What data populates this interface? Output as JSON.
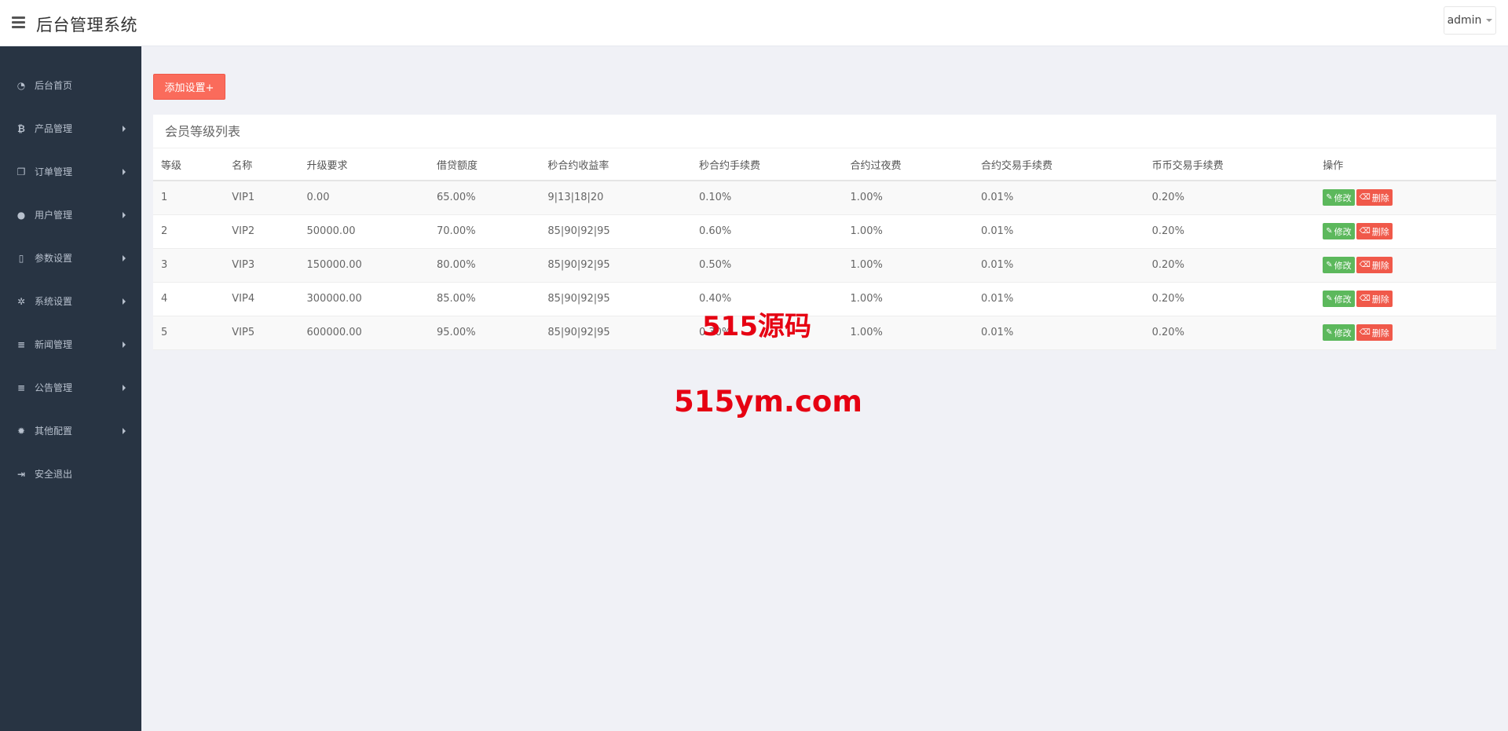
{
  "header": {
    "title": "后台管理系统",
    "user": "admin"
  },
  "sidebar": {
    "items": [
      {
        "label": "后台首页",
        "icon": "dashboard-icon",
        "has_arrow": false
      },
      {
        "label": "产品管理",
        "icon": "bitcoin-icon",
        "has_arrow": true
      },
      {
        "label": "订单管理",
        "icon": "copy-icon",
        "has_arrow": true
      },
      {
        "label": "用户管理",
        "icon": "user-icon",
        "has_arrow": true
      },
      {
        "label": "参数设置",
        "icon": "file-icon",
        "has_arrow": true
      },
      {
        "label": "系统设置",
        "icon": "gears-icon",
        "has_arrow": true
      },
      {
        "label": "新闻管理",
        "icon": "list-icon",
        "has_arrow": true
      },
      {
        "label": "公告管理",
        "icon": "list-icon",
        "has_arrow": true
      },
      {
        "label": "其他配置",
        "icon": "gear-icon",
        "has_arrow": true
      },
      {
        "label": "安全退出",
        "icon": "sign-out-icon",
        "has_arrow": false
      }
    ]
  },
  "main": {
    "add_button": "添加设置+",
    "panel_title": "会员等级列表",
    "table": {
      "headers": [
        "等级",
        "名称",
        "升级要求",
        "借贷额度",
        "秒合约收益率",
        "秒合约手续费",
        "合约过夜费",
        "合约交易手续费",
        "币币交易手续费",
        "操作"
      ],
      "rows": [
        [
          "1",
          "VIP1",
          "0.00",
          "65.00%",
          "9|13|18|20",
          "0.10%",
          "1.00%",
          "0.01%",
          "0.20%"
        ],
        [
          "2",
          "VIP2",
          "50000.00",
          "70.00%",
          "85|90|92|95",
          "0.60%",
          "1.00%",
          "0.01%",
          "0.20%"
        ],
        [
          "3",
          "VIP3",
          "150000.00",
          "80.00%",
          "85|90|92|95",
          "0.50%",
          "1.00%",
          "0.01%",
          "0.20%"
        ],
        [
          "4",
          "VIP4",
          "300000.00",
          "85.00%",
          "85|90|92|95",
          "0.40%",
          "1.00%",
          "0.01%",
          "0.20%"
        ],
        [
          "5",
          "VIP5",
          "600000.00",
          "95.00%",
          "85|90|92|95",
          "0.30%",
          "1.00%",
          "0.01%",
          "0.20%"
        ]
      ],
      "edit_label": "修改",
      "delete_label": "删除"
    }
  },
  "watermark": {
    "line1": "515源码",
    "line2": "515ym.com"
  },
  "colors": {
    "sidebar_bg": "#283443",
    "accent_red": "#fa6b5b",
    "edit_green": "#5cb85c",
    "watermark_red": "#e60012"
  }
}
